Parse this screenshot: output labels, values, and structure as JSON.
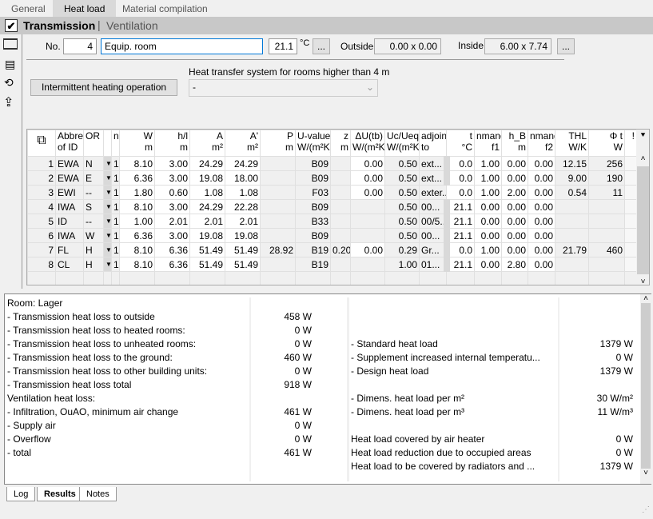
{
  "tabs": [
    "General",
    "Heat load",
    "Material compilation"
  ],
  "active_tab": "Heat load",
  "section": {
    "transmission": "Transmission",
    "separator": "|",
    "ventilation": "Ventilation"
  },
  "room": {
    "no_label": "No.",
    "no": "4",
    "name": "Equip. room",
    "temp": "21.1",
    "temp_unit": "°C",
    "more": "...",
    "outside_label": "Outside",
    "outside": "0.00 x 0.00",
    "inside_label": "Inside",
    "inside": "6.00 x 7.74",
    "inside_more": "..."
  },
  "intermittent_button": "Intermittent heating operation",
  "heat_transfer": {
    "label": "Heat transfer system for rooms higher than 4 m",
    "value": "-"
  },
  "table": {
    "headers": [
      [
        "",
        ""
      ],
      [
        "Abbrev",
        "of ID"
      ],
      [
        "OR",
        ""
      ],
      [
        "",
        ""
      ],
      [
        "n",
        ""
      ],
      [
        "W",
        "m"
      ],
      [
        "h/l",
        "m"
      ],
      [
        "A",
        "m²"
      ],
      [
        "A'",
        "m²"
      ],
      [
        "P",
        "m"
      ],
      [
        "U-value",
        "W/(m²K)"
      ],
      [
        "z",
        "m"
      ],
      [
        "ΔU(tb)",
        "W/(m²K)"
      ],
      [
        "Uc/Ueq",
        "W/(m²K)"
      ],
      [
        "adjoini",
        "to"
      ],
      [
        "t",
        "°C"
      ],
      [
        "nmand",
        "f1"
      ],
      [
        "h_B",
        "m"
      ],
      [
        "nmand",
        "f2"
      ],
      [
        "THL",
        "W/K"
      ],
      [
        "Φ t",
        "W"
      ],
      [
        "!",
        ""
      ]
    ],
    "rows": [
      [
        "1",
        "EWA",
        "N",
        "1",
        "8.10",
        "3.00",
        "24.29",
        "24.29",
        "",
        "B09",
        "",
        "0.00",
        "0.50",
        "ext...",
        "0.0",
        "1.00",
        "0.00",
        "0.00",
        "12.15",
        "256"
      ],
      [
        "2",
        "EWA",
        "E",
        "1",
        "6.36",
        "3.00",
        "19.08",
        "18.00",
        "",
        "B09",
        "",
        "0.00",
        "0.50",
        "ext...",
        "0.0",
        "1.00",
        "0.00",
        "0.00",
        "9.00",
        "190"
      ],
      [
        "3",
        "EWI",
        "--",
        "1",
        "1.80",
        "0.60",
        "1.08",
        "1.08",
        "",
        "F03",
        "",
        "0.00",
        "0.50",
        "exter...",
        "0.0",
        "1.00",
        "2.00",
        "0.00",
        "0.54",
        "11"
      ],
      [
        "4",
        "IWA",
        "S",
        "1",
        "8.10",
        "3.00",
        "24.29",
        "22.28",
        "",
        "B09",
        "",
        "",
        "0.50",
        "00...",
        "21.1",
        "0.00",
        "0.00",
        "0.00",
        "",
        ""
      ],
      [
        "5",
        "ID",
        "--",
        "1",
        "1.00",
        "2.01",
        "2.01",
        "2.01",
        "",
        "B33",
        "",
        "",
        "0.50",
        "00/5...",
        "21.1",
        "0.00",
        "0.00",
        "0.00",
        "",
        ""
      ],
      [
        "6",
        "IWA",
        "W",
        "1",
        "6.36",
        "3.00",
        "19.08",
        "19.08",
        "",
        "B09",
        "",
        "",
        "0.50",
        "00...",
        "21.1",
        "0.00",
        "0.00",
        "0.00",
        "",
        ""
      ],
      [
        "7",
        "FL",
        "H",
        "1",
        "8.10",
        "6.36",
        "51.49",
        "51.49",
        "28.92",
        "B19",
        "0.20",
        "0.00",
        "0.29",
        "Gr...",
        "0.0",
        "1.00",
        "0.00",
        "0.00",
        "21.79",
        "460"
      ],
      [
        "8",
        "CL",
        "H",
        "1",
        "8.10",
        "6.36",
        "51.49",
        "51.49",
        "",
        "B19",
        "",
        "",
        "1.00",
        "01...",
        "21.1",
        "0.00",
        "2.80",
        "0.00",
        "",
        ""
      ]
    ]
  },
  "results": {
    "left": [
      [
        "Room: Lager",
        ""
      ],
      [
        "- Transmission heat loss to outside",
        "458 W"
      ],
      [
        "- Transmission heat loss to heated rooms:",
        "0 W"
      ],
      [
        "- Transmission heat loss to unheated rooms:",
        "0 W"
      ],
      [
        "- Transmission heat loss to the ground:",
        "460 W"
      ],
      [
        "- Transmission heat loss to other building units:",
        "0 W"
      ],
      [
        "- Transmission heat loss total",
        "918 W"
      ],
      [
        "Ventilation heat loss:",
        ""
      ],
      [
        "- Infiltration, OuAO, minimum air change",
        "461 W"
      ],
      [
        "- Supply air",
        "0 W"
      ],
      [
        "- Overflow",
        "0 W"
      ],
      [
        "- total",
        "461 W"
      ]
    ],
    "right": [
      [
        "",
        ""
      ],
      [
        "",
        ""
      ],
      [
        "",
        ""
      ],
      [
        "- Standard heat load",
        "1379 W"
      ],
      [
        "- Supplement increased internal temperatu...",
        "0 W"
      ],
      [
        "- Design heat load",
        "1379 W"
      ],
      [
        "",
        ""
      ],
      [
        "- Dimens. heat load per m²",
        "30 W/m²"
      ],
      [
        "- Dimens. heat load per m³",
        "11 W/m³"
      ],
      [
        "",
        ""
      ],
      [
        "Heat load covered by air heater",
        "0 W"
      ],
      [
        "Heat load reduction due to occupied areas",
        "0 W"
      ],
      [
        "Heat load to be covered by radiators and ...",
        "1379 W"
      ]
    ]
  },
  "bottom_tabs": [
    "Log",
    "Results",
    "Notes"
  ],
  "active_bottom_tab": "Results"
}
